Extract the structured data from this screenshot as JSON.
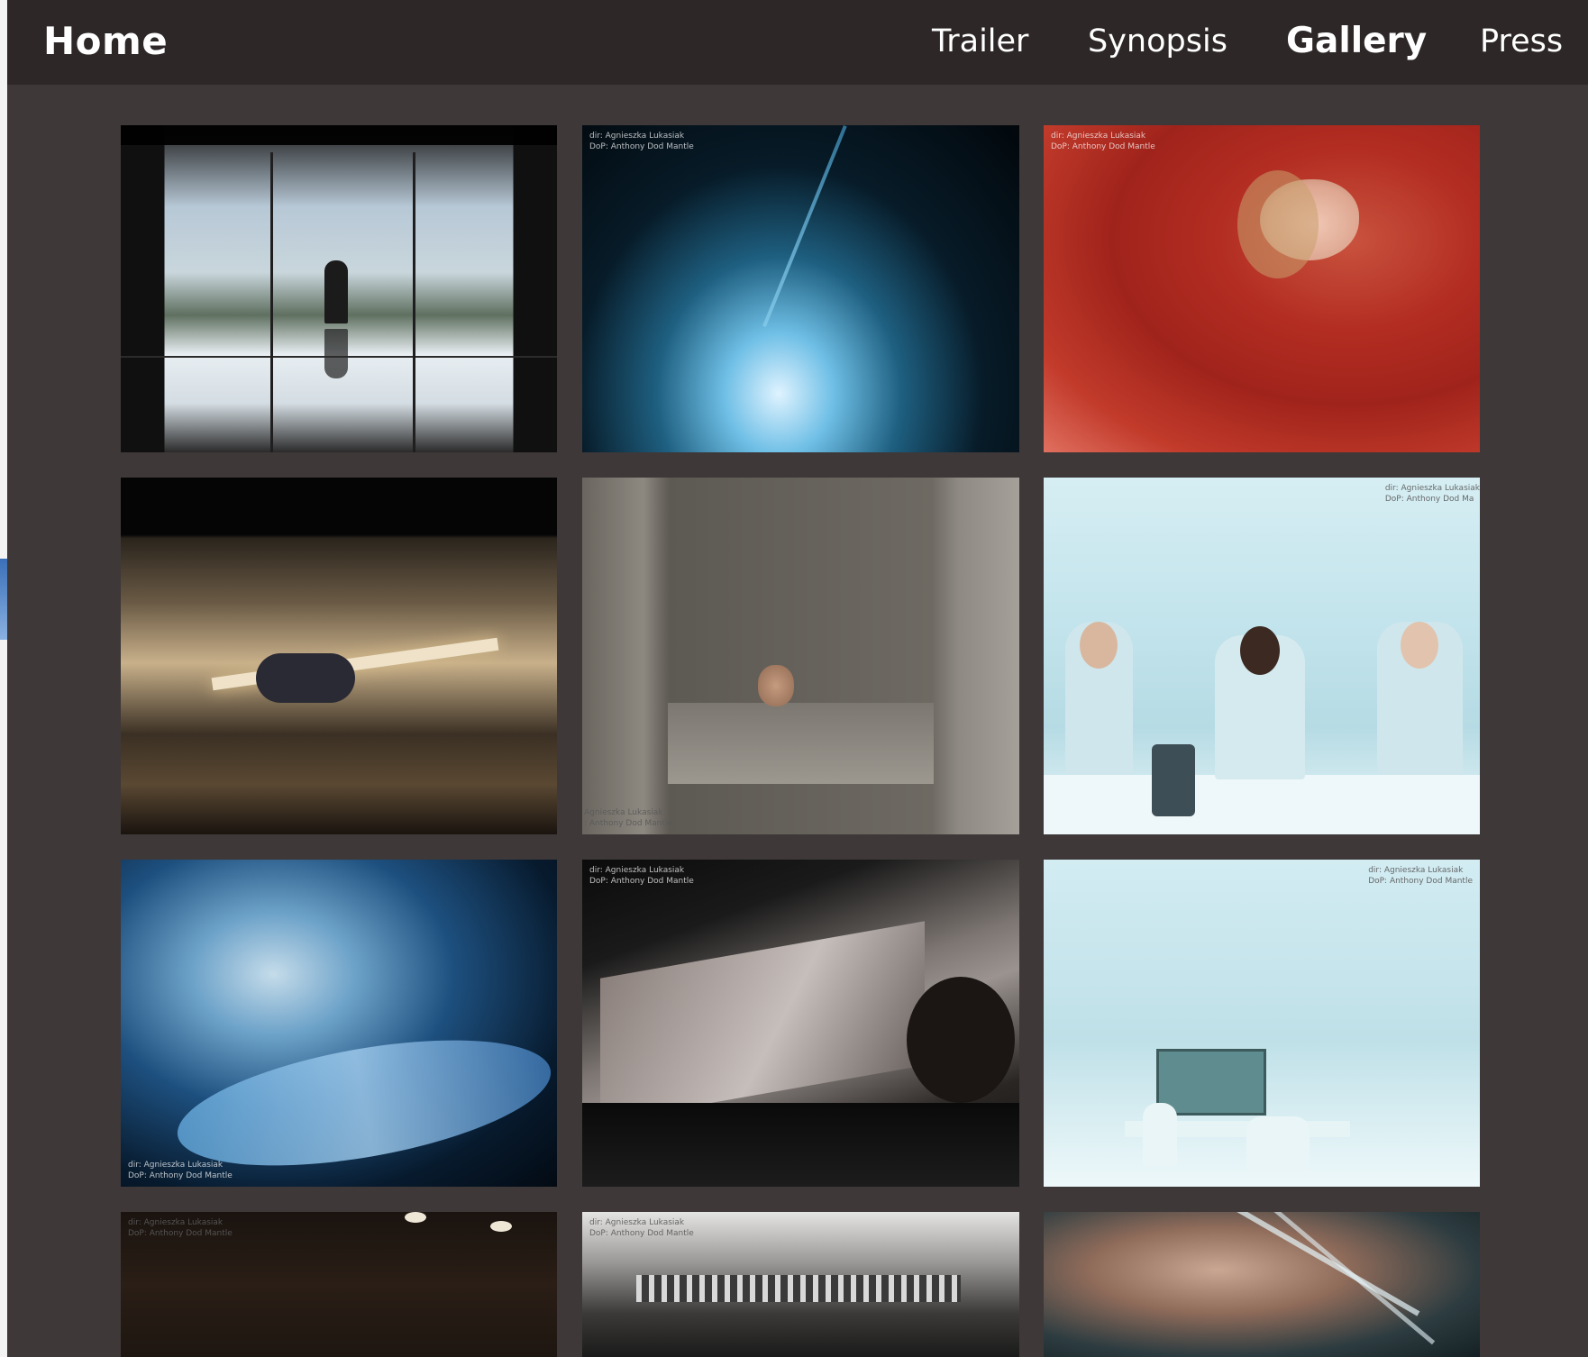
{
  "nav": {
    "home": "Home",
    "trailer": "Trailer",
    "synopsis": "Synopsis",
    "gallery": "Gallery",
    "press": "Press"
  },
  "gallery": {
    "credits": {
      "tile2": "dir: Agnieszka Lukasiak\nDoP: Anthony Dod Mantle",
      "tile3": "dir: Agnieszka Lukasiak\nDoP: Anthony Dod Mantle",
      "tile5": "Agnieszka Lukasiak\n: Anthony Dod Mantle",
      "tile6": "dir: Agnieszka Lukasiak\nDoP: Anthony Dod Ma",
      "tile7": "dir: Agnieszka Lukasiak\nDoP: Anthony Dod Mantle",
      "tile8": "dir: Agnieszka Lukasiak\nDoP: Anthony Dod Mantle",
      "tile9": "dir: Agnieszka Lukasiak\nDoP: Anthony Dod Mantle",
      "tile10": "dir: Agnieszka Lukasiak\nDoP: Anthony Dod Mantle",
      "tile11": "dir: Agnieszka Lukasiak\nDoP: Anthony Dod Mantle"
    }
  },
  "colors": {
    "page_bg": "#3e3838",
    "topbar_bg": "#2d2727",
    "nav_text": "#ffffff"
  }
}
